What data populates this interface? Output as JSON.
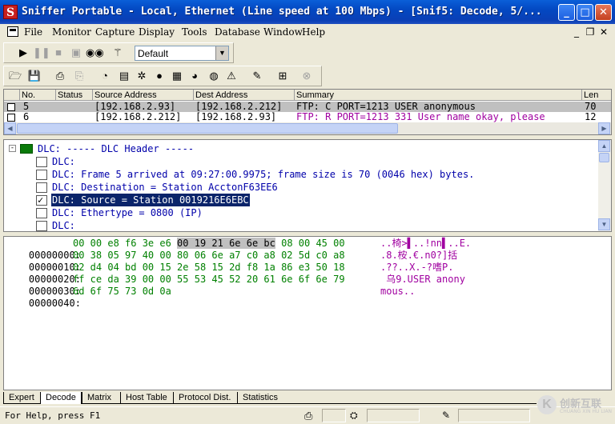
{
  "window": {
    "title": "Sniffer Portable - Local, Ethernet (Line speed at 100 Mbps) - [Snif5: Decode, 5/...",
    "app_icon": "S",
    "controls": {
      "minimize": "_",
      "maximize": "□",
      "close": "✕"
    }
  },
  "menu": {
    "items": [
      "File",
      "Monitor",
      "Capture",
      "Display",
      "Tools",
      "Database",
      "Window",
      "Help"
    ],
    "mdi_controls": [
      "_",
      "❐",
      "✕"
    ]
  },
  "toolbar1": {
    "profile_select": "Default",
    "icons": [
      "play-icon",
      "pause-icon",
      "stop-icon",
      "stop-display-icon",
      "binoculars-icon",
      "filter-wand-icon"
    ]
  },
  "toolbar2": {
    "icons": [
      "open-folder-icon",
      "save-icon",
      "print-icon",
      "print-preview-icon",
      "dashboard-icon",
      "host-table-icon",
      "matrix-icon",
      "art-icon",
      "history-icon",
      "protocol-dist-icon",
      "global-stats-icon",
      "alarm-icon",
      "define-filter-icon",
      "select-filter-icon",
      "stop-capture-icon"
    ]
  },
  "summary": {
    "columns": [
      "No.",
      "Status",
      "Source Address",
      "Dest Address",
      "Summary",
      "Len"
    ],
    "rows": [
      {
        "no": "5",
        "status": "",
        "source": "[192.168.2.93]",
        "dest": "[192.168.2.212]",
        "summary": "FTP: C PORT=1213   USER anonymous",
        "len": "70",
        "selected": true,
        "color": "#000000"
      },
      {
        "no": "6",
        "status": "",
        "source": "[192.168.2.212]",
        "dest": "[192.168.2.93]",
        "summary": "FTP: R PORT=1213   331 User name okay, please",
        "len": "12",
        "selected": false,
        "color": "#a000a0"
      }
    ]
  },
  "detail": {
    "rows": [
      {
        "text": "DLC:  ----- DLC Header -----",
        "kind": "header"
      },
      {
        "text": "DLC:",
        "kind": "item"
      },
      {
        "text": "DLC:  Frame 5 arrived at  09:27:00.9975; frame size is 70 (0046 hex) bytes.",
        "kind": "item"
      },
      {
        "text": "DLC:  Destination = Station AcctonF63EE6",
        "kind": "item"
      },
      {
        "text": "DLC:  Source      = Station 0019216E6EBC",
        "kind": "item-checked",
        "selected": true
      },
      {
        "text": "DLC:  Ethertype   = 0800 (IP)",
        "kind": "item"
      },
      {
        "text": "DLC:",
        "kind": "item"
      }
    ]
  },
  "hex": {
    "rows": [
      {
        "offset": "00000000:",
        "pre": "00 00 e8 f6 3e e6 ",
        "hl": "00 19 21 6e 6e bc",
        "post": " 08 00 45 00",
        "ascii": "..椅>▌..!nn▌..E."
      },
      {
        "offset": "00000010:",
        "pre": "00 38 05 97 40 00 80 06 6e a7 c0 a8 02 5d c0 a8",
        "hl": "",
        "post": "",
        "ascii": ".8.桉.€.n0?]括"
      },
      {
        "offset": "00000020:",
        "pre": "02 d4 04 bd 00 15 2e 58 15 2d f8 1a 86 e3 50 18",
        "hl": "",
        "post": "",
        "ascii": ".??..X.-?嗜P."
      },
      {
        "offset": "00000030:",
        "pre": "ff ce da 39 00 00 55 53 45 52 20 61 6e 6f 6e 79",
        "hl": "",
        "post": "",
        "ascii": " 乌9.USER anony"
      },
      {
        "offset": "00000040:",
        "pre": "6d 6f 75 73 0d 0a",
        "hl": "",
        "post": "",
        "ascii": "mous.."
      }
    ]
  },
  "tabs": [
    "Expert",
    "Decode",
    "Matrix",
    "Host Table",
    "Protocol Dist.",
    "Statistics"
  ],
  "active_tab": "Decode",
  "status": {
    "text": "For Help, press F1"
  },
  "watermark": {
    "logo": "K",
    "text": "创新互联",
    "sub": "CHUANG XIN HU LIAN"
  }
}
